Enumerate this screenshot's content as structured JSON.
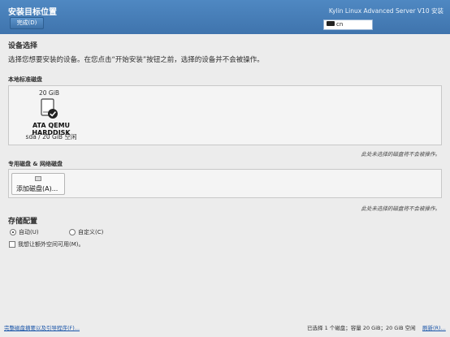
{
  "header": {
    "title": "安装目标位置",
    "done_label": "完成(D)",
    "os_title": "Kylin Linux Advanced Server V10 安装",
    "keyboard_layout": "cn"
  },
  "device_selection": {
    "heading": "设备选择",
    "description": "选择您想要安装的设备。在您点击“开始安装”按钮之前，选择的设备并不会被操作。"
  },
  "local_disks": {
    "heading": "本地标准磁盘",
    "disks": [
      {
        "size": "20 GiB",
        "name": "ATA QEMU HARDDISK",
        "device": "sda",
        "separator": "/",
        "free": "20 GiB 空闲",
        "selected": true
      }
    ],
    "note": "此处未选择的磁盘将不会被操作。"
  },
  "specialized_disks": {
    "heading": "专用磁盘 & 网络磁盘",
    "add_disk_label": "添加磁盘(A)...",
    "note": "此处未选择的磁盘将不会被操作。"
  },
  "storage_config": {
    "heading": "存储配置",
    "auto_label": "自动(U)",
    "custom_label": "自定义(C)",
    "selected": "auto",
    "extra_space_label": "我想让额外空间可用(M)。",
    "extra_space_checked": false
  },
  "footer": {
    "summary_link": "完整磁盘摘要以及引导程序(F)...",
    "status": "已选择 1 个磁盘；容量 20 GiB；20 GiB 空闲",
    "refresh_link": "刷新(R)..."
  }
}
